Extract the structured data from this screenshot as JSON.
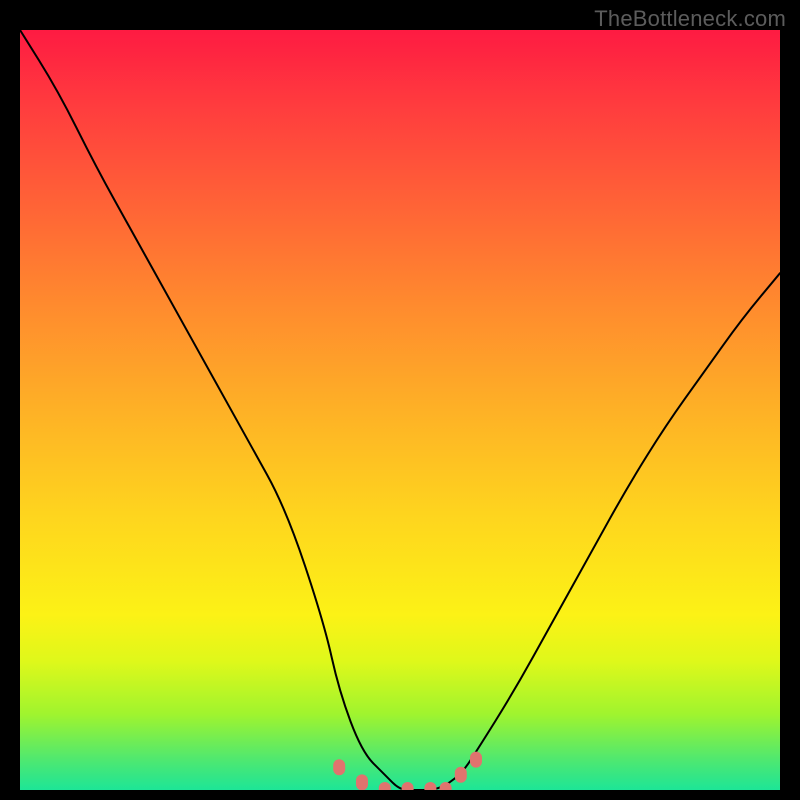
{
  "watermark": "TheBottleneck.com",
  "chart_data": {
    "type": "line",
    "title": "",
    "xlabel": "",
    "ylabel": "",
    "ylim": [
      0,
      100
    ],
    "x": [
      0,
      5,
      10,
      15,
      20,
      25,
      30,
      35,
      40,
      42,
      45,
      48,
      50,
      52,
      55,
      58,
      60,
      65,
      70,
      75,
      80,
      85,
      90,
      95,
      100
    ],
    "series": [
      {
        "name": "bottleneck-curve",
        "values": [
          100,
          92,
          82,
          73,
          64,
          55,
          46,
          37,
          22,
          13,
          5,
          2,
          0,
          0,
          0,
          2,
          5,
          13,
          22,
          31,
          40,
          48,
          55,
          62,
          68
        ]
      }
    ],
    "markers": {
      "name": "highlight-band",
      "x": [
        42,
        45,
        48,
        51,
        54,
        56,
        58,
        60
      ],
      "y": [
        3,
        1,
        0,
        0,
        0,
        0,
        2,
        4
      ]
    },
    "gradient_stops": [
      {
        "pct": 0,
        "color": "#fe1b42"
      },
      {
        "pct": 50,
        "color": "#fed51e"
      },
      {
        "pct": 100,
        "color": "#1de597"
      }
    ]
  }
}
